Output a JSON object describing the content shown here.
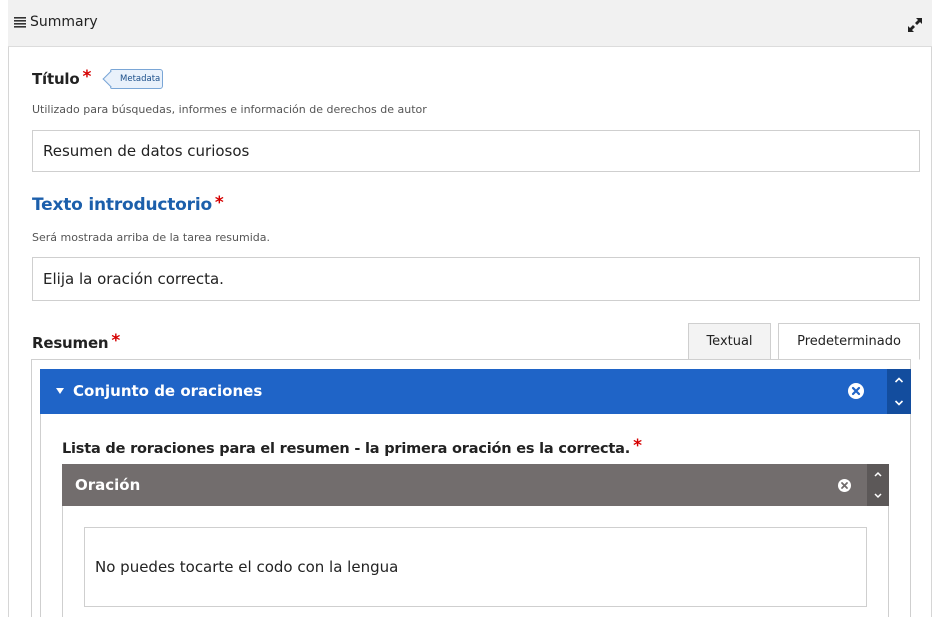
{
  "topbar": {
    "title": "Summary",
    "list_icon": "list-icon",
    "expand_icon": "expand-icon"
  },
  "title_field": {
    "label": "Título",
    "required_mark": "*",
    "badge": "Metadata",
    "description": "Utilizado para búsquedas, informes e información de derechos de autor",
    "value": "Resumen de datos curiosos"
  },
  "intro_field": {
    "label": "Texto introductorio",
    "required_mark": "*",
    "description": "Será mostrada arriba de la tarea resumida.",
    "value": "Elija la oración correcta."
  },
  "summary_field": {
    "label": "Resumen",
    "required_mark": "*",
    "tabs": [
      {
        "label": "Textual",
        "active": false
      },
      {
        "label": "Predeterminado",
        "active": true
      }
    ]
  },
  "sentence_set": {
    "header": "Conjunto de oraciones",
    "list_label": "Lista de roraciones para el resumen - la primera oración es la correcta.",
    "required_mark": "*",
    "item": {
      "header": "Oración",
      "value": "No puedes tocarte el codo con la lengua"
    }
  },
  "colors": {
    "accent_blue": "#1f64c7",
    "item_header_gray": "#726d6d",
    "required_red": "#d50000",
    "link_blue": "#1c5fab"
  }
}
